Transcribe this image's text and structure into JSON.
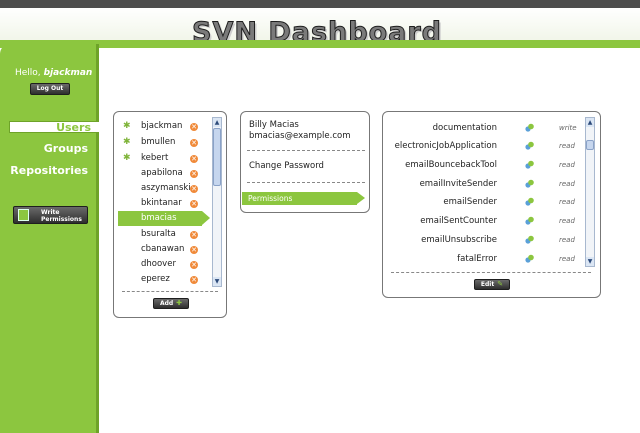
{
  "app": {
    "title": "SVN Dashboard"
  },
  "sidebar": {
    "hello_prefix": "Hello,",
    "username": "bjackman",
    "logout_label": "Log Out",
    "nav": [
      {
        "label": "Users",
        "active": true
      },
      {
        "label": "Groups",
        "active": false
      },
      {
        "label": "Repositories",
        "active": false
      }
    ],
    "write_permissions_line1": "Write",
    "write_permissions_line2": "Permissions"
  },
  "users": {
    "items": [
      {
        "name": "bjackman",
        "admin": true
      },
      {
        "name": "bmullen",
        "admin": true
      },
      {
        "name": "kebert",
        "admin": true
      },
      {
        "name": "apabilona",
        "admin": false
      },
      {
        "name": "aszymanski",
        "admin": false
      },
      {
        "name": "bkintanar",
        "admin": false
      },
      {
        "name": "bmacias",
        "admin": false,
        "selected": true
      },
      {
        "name": "bsuralta",
        "admin": false
      },
      {
        "name": "cbanawan",
        "admin": false
      },
      {
        "name": "dhoover",
        "admin": false
      },
      {
        "name": "eperez",
        "admin": false
      }
    ],
    "add_label": "Add"
  },
  "detail": {
    "full_name": "Billy Macias",
    "email": "bmacias@example.com",
    "change_password_label": "Change Password",
    "permissions_label": "Permissions"
  },
  "repositories": {
    "items": [
      {
        "name": "documentation",
        "perm": "write"
      },
      {
        "name": "electronicJobApplication",
        "perm": "read"
      },
      {
        "name": "emailBouncebackTool",
        "perm": "read"
      },
      {
        "name": "emailInviteSender",
        "perm": "read"
      },
      {
        "name": "emailSender",
        "perm": "read"
      },
      {
        "name": "emailSentCounter",
        "perm": "read"
      },
      {
        "name": "emailUnsubscribe",
        "perm": "read"
      },
      {
        "name": "fatalError",
        "perm": "read"
      }
    ],
    "edit_label": "Edit"
  },
  "colors": {
    "accent": "#8cc63f",
    "dark": "#4d4d4d"
  }
}
